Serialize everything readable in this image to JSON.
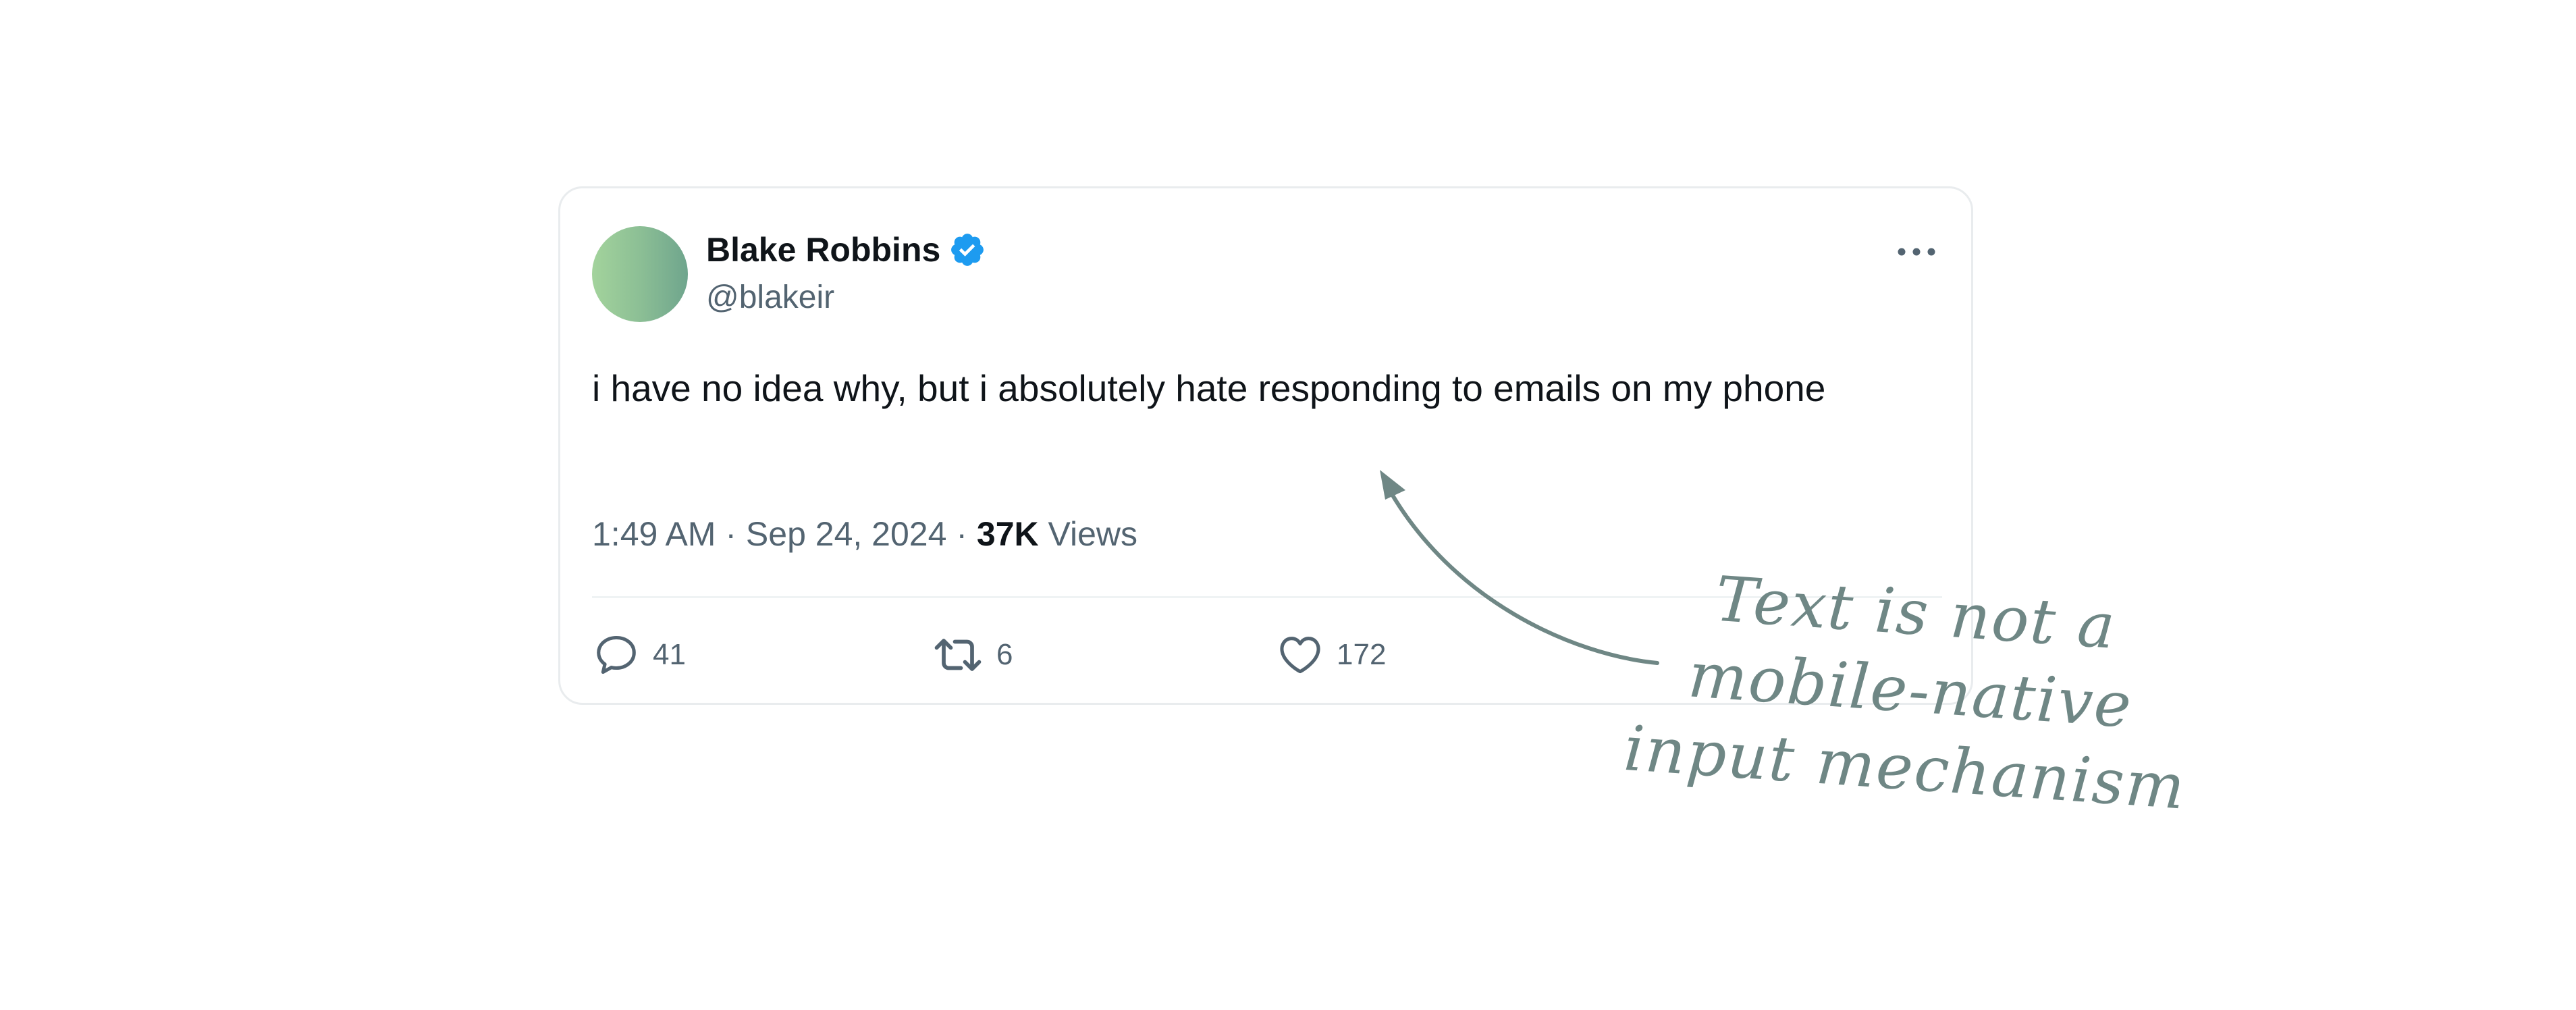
{
  "tweet": {
    "author": {
      "display_name": "Blake Robbins",
      "handle": "@blakeir",
      "verified": true,
      "verified_color": "#1d9bf0"
    },
    "text": "i have no idea why, but i absolutely hate responding to emails on my phone",
    "meta": {
      "time": "1:49 AM",
      "separator": "·",
      "date": "Sep 24, 2024",
      "views_count": "37K",
      "views_label": "Views"
    },
    "actions": {
      "replies": "41",
      "retweets": "6",
      "likes": "172"
    },
    "icons": {
      "more": "ellipsis-icon",
      "reply": "speech-bubble-icon",
      "retweet": "retweet-icon",
      "like": "heart-icon"
    }
  },
  "annotation": {
    "lines": [
      "Text is not a",
      "mobile-native",
      "input mechanism"
    ],
    "color": "#6f8785"
  }
}
